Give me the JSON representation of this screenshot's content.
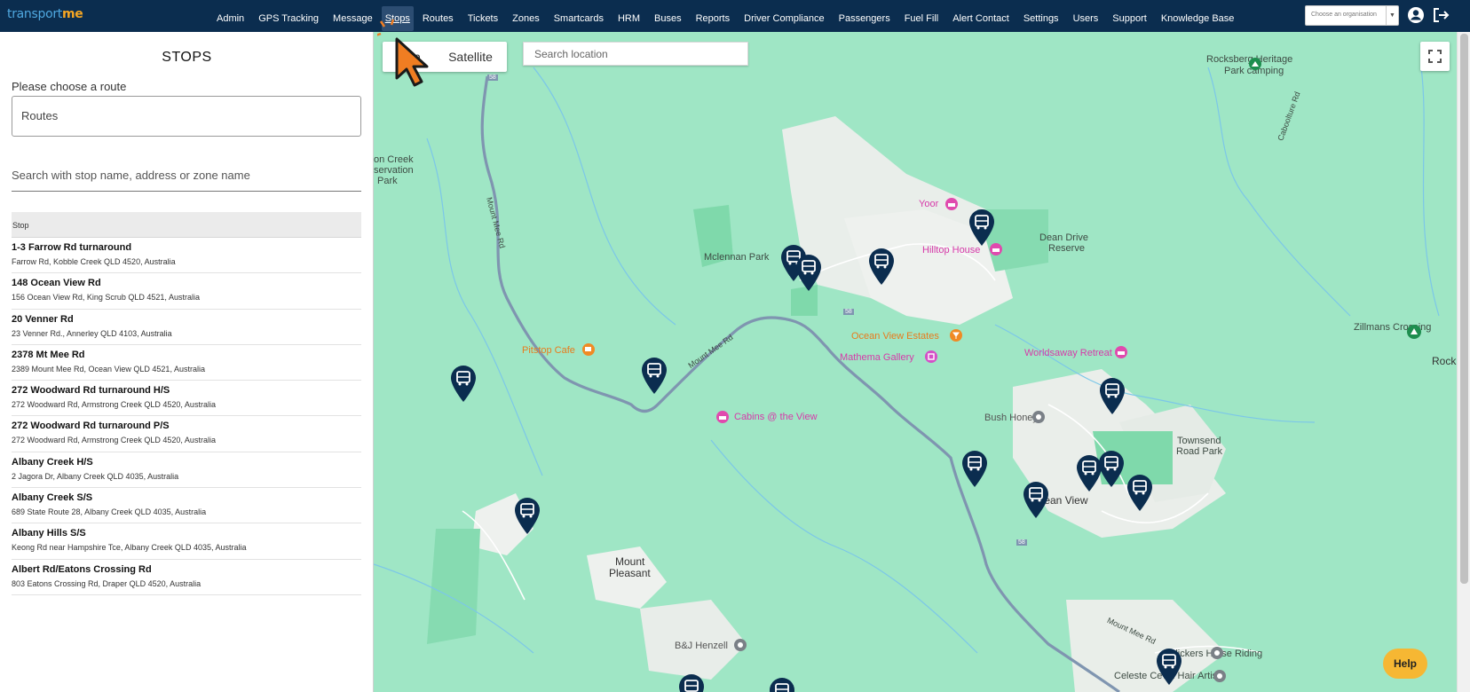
{
  "header": {
    "logo_text_a": "transport",
    "logo_text_b": "me",
    "nav": [
      "Admin",
      "GPS Tracking",
      "Message",
      "Stops",
      "Routes",
      "Tickets",
      "Zones",
      "Smartcards",
      "HRM",
      "Buses",
      "Reports",
      "Driver Compliance",
      "Passengers",
      "Fuel Fill",
      "Alert Contact",
      "Settings",
      "Users",
      "Support",
      "Knowledge Base"
    ],
    "active_nav": "Stops",
    "org_placeholder": "Choose an organisation",
    "user_icon": "user-circle-icon",
    "logout_icon": "logout-icon"
  },
  "sidebar": {
    "title": "STOPS",
    "route_label": "Please choose a route",
    "route_value": "Routes",
    "search_placeholder": "Search with stop name, address or zone name",
    "column_header": "Stop",
    "stops": [
      {
        "name": "1-3 Farrow Rd turnaround",
        "address": "Farrow Rd, Kobble Creek QLD 4520, Australia"
      },
      {
        "name": "148 Ocean View Rd",
        "address": "156 Ocean View Rd, King Scrub QLD 4521, Australia"
      },
      {
        "name": "20 Venner Rd",
        "address": "23 Venner Rd., Annerley QLD 4103, Australia"
      },
      {
        "name": "2378 Mt Mee Rd",
        "address": "2389 Mount Mee Rd, Ocean View QLD 4521, Australia"
      },
      {
        "name": "272 Woodward Rd turnaround H/S",
        "address": "272 Woodward Rd, Armstrong Creek QLD 4520, Australia"
      },
      {
        "name": "272 Woodward Rd turnaround P/S",
        "address": "272 Woodward Rd, Armstrong Creek QLD 4520, Australia"
      },
      {
        "name": "Albany Creek H/S",
        "address": "2 Jagora Dr, Albany Creek QLD 4035, Australia"
      },
      {
        "name": "Albany Creek S/S",
        "address": "689 State Route 28, Albany Creek QLD 4035, Australia"
      },
      {
        "name": "Albany Hills S/S",
        "address": "Keong Rd near Hampshire Tce, Albany Creek QLD 4035, Australia"
      },
      {
        "name": "Albert Rd/Eatons Crossing Rd",
        "address": "803 Eatons Crossing Rd, Draper QLD 4520, Australia"
      }
    ]
  },
  "map": {
    "type_map": "Map",
    "type_satellite": "Satellite",
    "search_placeholder": "Search location",
    "help": "Help",
    "labels": {
      "rocksberg": "Rocksberg Heritage",
      "rocksberg2": "Park camping",
      "caboolture": "Caboolture Rd",
      "oncreek": "on Creek",
      "servation": "servation",
      "park": "Park",
      "yoor": "Yoor",
      "hilltop": "Hilltop House",
      "deandrive": "Dean Drive",
      "reserve": "Reserve",
      "mclennan": "Mclennan Park",
      "oceanestates": "Ocean View Estates",
      "mathema": "Mathema Gallery",
      "worldsaway": "Worldsaway Retreat",
      "zillmans": "Zillmans Crossing",
      "rock": "Rock",
      "pitstop": "Pitstop Cafe",
      "cabins": "Cabins @ the View",
      "bushhoney": "Bush Honey",
      "townsend": "Townsend",
      "roadpark": "Road Park",
      "oceanview": "Ocean View",
      "mount": "Mount",
      "pleasant": "Pleasant",
      "bjhenzell": "B&J Henzell",
      "slickers": "Slickers Horse Riding",
      "celeste": "Celeste Ceval Hair Artist",
      "mountmee1": "Mount Mee Rd",
      "mountmee2": "Mount Mee Rd",
      "mountmee3": "Mount Mee Rd",
      "r58a": "58",
      "r58b": "58",
      "r58c": "58"
    }
  }
}
